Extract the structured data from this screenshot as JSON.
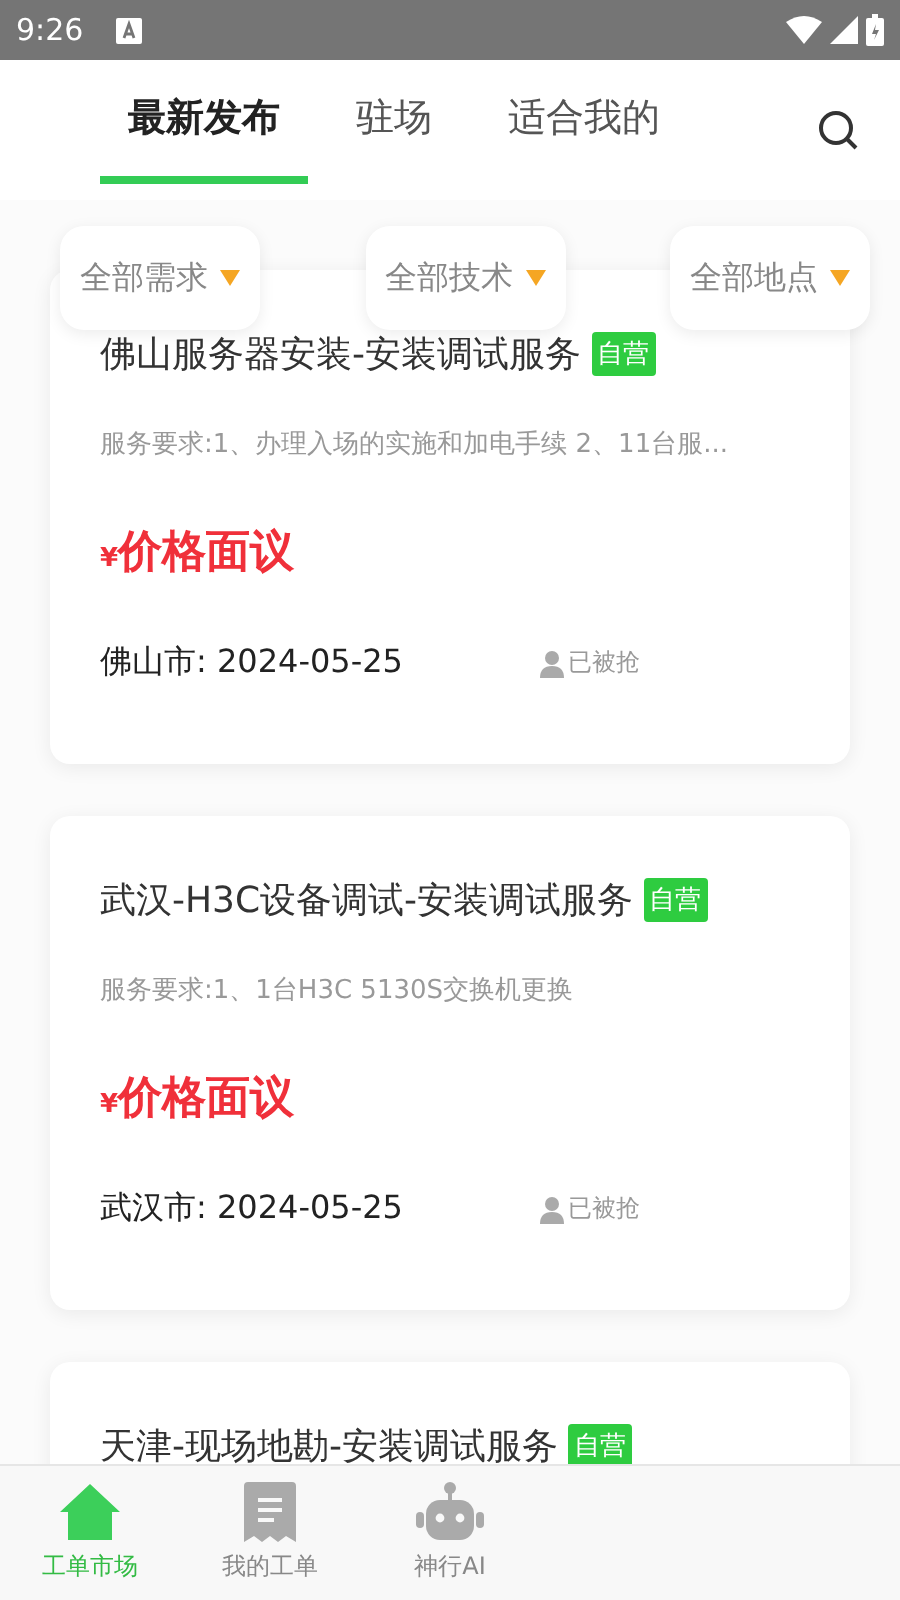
{
  "status_bar": {
    "time": "9:26"
  },
  "tabs": [
    {
      "label": "最新发布",
      "selected": true
    },
    {
      "label": "驻场",
      "selected": false
    },
    {
      "label": "适合我的",
      "selected": false
    }
  ],
  "filters": [
    {
      "label": "全部需求"
    },
    {
      "label": "全部技术"
    },
    {
      "label": "全部地点"
    }
  ],
  "orders": [
    {
      "title": "佛山服务器安装-安装调试服务",
      "badge": "自营",
      "requirement": "服务要求:1、办理入场的实施和加电手续 2、11台服...",
      "currency": "¥",
      "price": "价格面议",
      "location_date": "佛山市: 2024-05-25",
      "status": "已被抢"
    },
    {
      "title": "武汉-H3C设备调试-安装调试服务",
      "badge": "自营",
      "requirement": "服务要求:1、1台H3C 5130S交换机更换",
      "currency": "¥",
      "price": "价格面议",
      "location_date": "武汉市: 2024-05-25",
      "status": "已被抢"
    },
    {
      "title": "天津-现场地勘-安装调试服务",
      "badge": "自营"
    }
  ],
  "bottom_nav": [
    {
      "label": "工单市场",
      "selected": true
    },
    {
      "label": "我的工单",
      "selected": false
    },
    {
      "label": "神行AI",
      "selected": false
    }
  ]
}
